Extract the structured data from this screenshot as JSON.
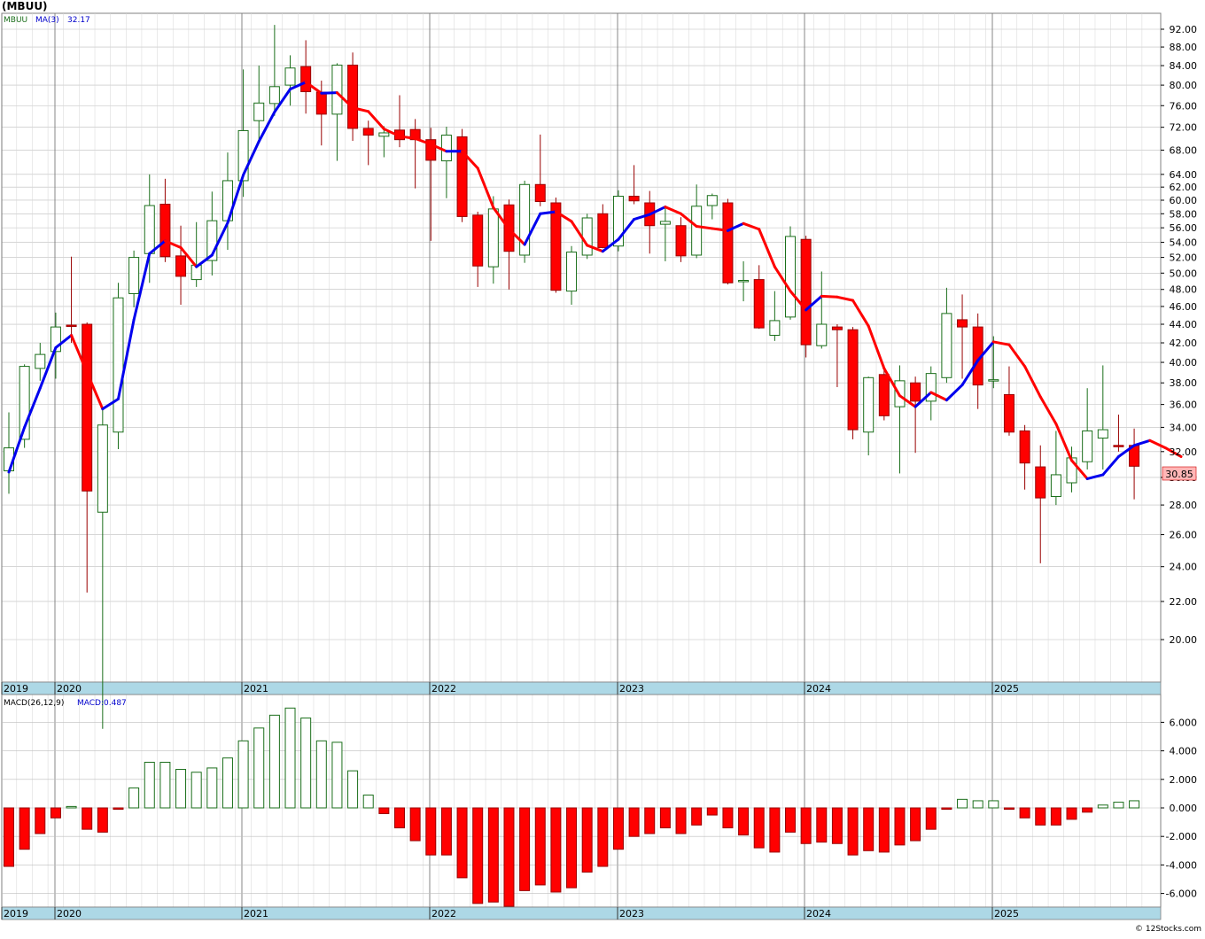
{
  "header": {
    "title": "(MBUU)",
    "legend_symbol": "MBUU",
    "legend_ma": "MA(3)",
    "legend_ma_value": "32.17",
    "macd_label": "MACD(26,12,9)",
    "macd_value_label": "MACD:0.487",
    "price_badge": "30.85",
    "footer": "© 12Stocks.com"
  },
  "colors": {
    "up": "#1a6e1a",
    "down": "#ff0000",
    "ma_up": "#0000ee",
    "ma_down": "#ff0000",
    "grid": "#bdbdbd",
    "year_band": "#add8e6",
    "badge_bg": "#ffb6b6"
  },
  "chart_data": [
    {
      "type": "candlestick",
      "name": "price",
      "y_ticks": [
        "92.00",
        "88.00",
        "84.00",
        "80.00",
        "76.00",
        "72.00",
        "68.00",
        "64.00",
        "62.00",
        "60.00",
        "58.00",
        "56.00",
        "54.00",
        "52.00",
        "50.00",
        "48.00",
        "46.00",
        "44.00",
        "42.00",
        "40.00",
        "38.00",
        "36.00",
        "34.00",
        "32.00",
        "30.00",
        "28.00",
        "26.00",
        "24.00",
        "22.00",
        "20.00"
      ],
      "x_labels": [
        "2019",
        "2020",
        "2021",
        "2022",
        "2023",
        "2024",
        "2025"
      ],
      "ylim": [
        17.5,
        96
      ],
      "scale": "log",
      "ma": [
        30.4,
        34.0,
        37.5,
        41.5,
        42.8,
        39.0,
        35.6,
        36.5,
        44.5,
        52.5,
        54.2,
        53.3,
        50.8,
        52.3,
        56.7,
        63.9,
        69.5,
        74.8,
        79.2,
        80.6,
        78.4,
        78.5,
        75.6,
        74.9,
        71.7,
        70.4,
        70.0,
        69.0,
        67.8,
        67.8,
        65.0,
        58.9,
        55.8,
        53.7,
        58.0,
        58.3,
        56.9,
        53.6,
        52.8,
        54.4,
        57.2,
        57.9,
        59.0,
        58.0,
        56.2,
        55.9,
        55.6,
        56.6,
        55.8,
        50.8,
        47.8,
        45.6,
        47.2,
        47.1,
        46.7,
        43.8,
        39.4,
        36.8,
        35.8,
        37.1,
        36.4,
        37.8,
        40.2,
        42.1,
        41.8,
        39.6,
        36.7,
        34.3,
        31.3,
        29.9,
        30.2,
        31.6,
        32.5,
        32.9,
        32.3,
        31.6
      ],
      "candles": [
        {
          "o": 30.5,
          "h": 35.3,
          "l": 28.8,
          "c": 32.3
        },
        {
          "o": 33.0,
          "h": 39.8,
          "l": 32.3,
          "c": 39.6
        },
        {
          "o": 39.4,
          "h": 42.0,
          "l": 38.2,
          "c": 40.8
        },
        {
          "o": 41.1,
          "h": 45.3,
          "l": 38.4,
          "c": 43.7
        },
        {
          "o": 43.9,
          "h": 52.1,
          "l": 42.0,
          "c": 43.8
        },
        {
          "o": 44.0,
          "h": 44.2,
          "l": 22.5,
          "c": 29.0
        },
        {
          "o": 27.5,
          "h": 35.6,
          "l": 16.0,
          "c": 34.2
        },
        {
          "o": 33.6,
          "h": 48.8,
          "l": 32.2,
          "c": 47.0
        },
        {
          "o": 47.5,
          "h": 52.9,
          "l": 45.9,
          "c": 52.0
        },
        {
          "o": 52.5,
          "h": 64.0,
          "l": 48.8,
          "c": 59.2
        },
        {
          "o": 59.4,
          "h": 63.3,
          "l": 51.4,
          "c": 52.1
        },
        {
          "o": 52.2,
          "h": 56.3,
          "l": 46.2,
          "c": 49.6
        },
        {
          "o": 49.2,
          "h": 56.8,
          "l": 48.3,
          "c": 51.0
        },
        {
          "o": 51.6,
          "h": 61.3,
          "l": 49.7,
          "c": 57.0
        },
        {
          "o": 57.0,
          "h": 67.6,
          "l": 53.0,
          "c": 63.0
        },
        {
          "o": 63.0,
          "h": 83.2,
          "l": 60.5,
          "c": 71.4
        },
        {
          "o": 73.2,
          "h": 84.0,
          "l": 69.5,
          "c": 76.5
        },
        {
          "o": 76.4,
          "h": 93.0,
          "l": 74.1,
          "c": 79.7
        },
        {
          "o": 80.0,
          "h": 86.2,
          "l": 76.0,
          "c": 83.5
        },
        {
          "o": 83.8,
          "h": 89.5,
          "l": 74.5,
          "c": 78.7
        },
        {
          "o": 78.6,
          "h": 80.9,
          "l": 68.8,
          "c": 74.4
        },
        {
          "o": 74.4,
          "h": 84.5,
          "l": 66.2,
          "c": 84.1
        },
        {
          "o": 84.1,
          "h": 86.8,
          "l": 69.6,
          "c": 71.8
        },
        {
          "o": 71.8,
          "h": 73.2,
          "l": 65.5,
          "c": 70.6
        },
        {
          "o": 70.4,
          "h": 72.2,
          "l": 66.8,
          "c": 71.0
        },
        {
          "o": 71.5,
          "h": 78.0,
          "l": 68.5,
          "c": 69.8
        },
        {
          "o": 71.6,
          "h": 73.5,
          "l": 61.8,
          "c": 69.8
        },
        {
          "o": 69.8,
          "h": 71.9,
          "l": 54.2,
          "c": 66.3
        },
        {
          "o": 66.2,
          "h": 72.1,
          "l": 60.3,
          "c": 70.6
        },
        {
          "o": 70.3,
          "h": 71.7,
          "l": 56.8,
          "c": 57.6
        },
        {
          "o": 57.8,
          "h": 58.3,
          "l": 48.3,
          "c": 50.9
        },
        {
          "o": 50.8,
          "h": 60.6,
          "l": 48.7,
          "c": 58.7
        },
        {
          "o": 59.3,
          "h": 60.1,
          "l": 48.0,
          "c": 52.8
        },
        {
          "o": 52.3,
          "h": 63.0,
          "l": 51.3,
          "c": 62.4
        },
        {
          "o": 62.4,
          "h": 70.7,
          "l": 59.1,
          "c": 59.8
        },
        {
          "o": 59.6,
          "h": 60.4,
          "l": 47.6,
          "c": 47.9
        },
        {
          "o": 47.8,
          "h": 53.5,
          "l": 46.2,
          "c": 52.7
        },
        {
          "o": 52.3,
          "h": 58.0,
          "l": 51.8,
          "c": 57.4
        },
        {
          "o": 58.0,
          "h": 59.4,
          "l": 53.2,
          "c": 53.3
        },
        {
          "o": 53.5,
          "h": 61.5,
          "l": 52.8,
          "c": 60.6
        },
        {
          "o": 60.6,
          "h": 65.5,
          "l": 59.4,
          "c": 59.9
        },
        {
          "o": 59.6,
          "h": 61.4,
          "l": 52.5,
          "c": 56.3
        },
        {
          "o": 56.5,
          "h": 59.2,
          "l": 51.5,
          "c": 56.9
        },
        {
          "o": 56.3,
          "h": 57.5,
          "l": 51.4,
          "c": 52.2
        },
        {
          "o": 52.3,
          "h": 62.4,
          "l": 51.9,
          "c": 59.1
        },
        {
          "o": 59.2,
          "h": 61.0,
          "l": 57.2,
          "c": 60.7
        },
        {
          "o": 59.6,
          "h": 60.2,
          "l": 48.6,
          "c": 48.8
        },
        {
          "o": 49.0,
          "h": 51.5,
          "l": 46.6,
          "c": 49.1
        },
        {
          "o": 49.2,
          "h": 51.0,
          "l": 43.5,
          "c": 43.6
        },
        {
          "o": 42.8,
          "h": 47.8,
          "l": 42.2,
          "c": 44.4
        },
        {
          "o": 44.8,
          "h": 56.2,
          "l": 44.5,
          "c": 54.8
        },
        {
          "o": 54.4,
          "h": 54.9,
          "l": 40.5,
          "c": 41.8
        },
        {
          "o": 41.7,
          "h": 50.2,
          "l": 41.4,
          "c": 44.0
        },
        {
          "o": 43.7,
          "h": 44.0,
          "l": 37.6,
          "c": 43.4
        },
        {
          "o": 43.4,
          "h": 43.7,
          "l": 33.0,
          "c": 33.8
        },
        {
          "o": 33.6,
          "h": 38.6,
          "l": 31.7,
          "c": 38.5
        },
        {
          "o": 38.8,
          "h": 39.7,
          "l": 34.6,
          "c": 35.0
        },
        {
          "o": 35.8,
          "h": 39.7,
          "l": 30.3,
          "c": 38.2
        },
        {
          "o": 38.0,
          "h": 38.6,
          "l": 31.9,
          "c": 36.3
        },
        {
          "o": 36.3,
          "h": 39.6,
          "l": 34.6,
          "c": 38.9
        },
        {
          "o": 38.5,
          "h": 48.2,
          "l": 38.0,
          "c": 45.2
        },
        {
          "o": 44.5,
          "h": 47.4,
          "l": 38.4,
          "c": 43.7
        },
        {
          "o": 43.7,
          "h": 45.2,
          "l": 35.6,
          "c": 37.8
        },
        {
          "o": 38.2,
          "h": 42.7,
          "l": 37.5,
          "c": 38.3
        },
        {
          "o": 36.9,
          "h": 39.6,
          "l": 33.3,
          "c": 33.6
        },
        {
          "o": 33.7,
          "h": 34.2,
          "l": 29.1,
          "c": 31.1
        },
        {
          "o": 30.8,
          "h": 32.5,
          "l": 24.2,
          "c": 28.5
        },
        {
          "o": 28.6,
          "h": 33.7,
          "l": 28.0,
          "c": 30.2
        },
        {
          "o": 29.6,
          "h": 32.4,
          "l": 28.9,
          "c": 31.5
        },
        {
          "o": 31.2,
          "h": 37.5,
          "l": 30.6,
          "c": 33.7
        },
        {
          "o": 33.1,
          "h": 39.7,
          "l": 30.6,
          "c": 33.8
        },
        {
          "o": 32.5,
          "h": 35.1,
          "l": 32.0,
          "c": 32.4
        },
        {
          "o": 32.5,
          "h": 33.9,
          "l": 28.4,
          "c": 30.85
        }
      ]
    },
    {
      "type": "bar",
      "name": "macd-histogram",
      "y_ticks": [
        "6.000",
        "4.000",
        "2.000",
        "0.000",
        "-2.000",
        "-4.000",
        "-6.000"
      ],
      "ylim": [
        -7.0,
        7.3
      ],
      "values": [
        -4.1,
        -2.9,
        -1.8,
        -0.7,
        0.1,
        -1.5,
        -1.7,
        -0.1,
        1.4,
        3.2,
        3.2,
        2.7,
        2.5,
        2.8,
        3.5,
        4.7,
        5.6,
        6.5,
        7.0,
        6.3,
        4.7,
        4.6,
        2.6,
        0.9,
        -0.4,
        -1.4,
        -2.3,
        -3.3,
        -3.3,
        -4.9,
        -6.7,
        -6.6,
        -6.9,
        -5.8,
        -5.4,
        -5.9,
        -5.6,
        -4.5,
        -4.1,
        -2.9,
        -2.0,
        -1.8,
        -1.4,
        -1.8,
        -1.2,
        -0.5,
        -1.4,
        -1.9,
        -2.8,
        -3.1,
        -1.7,
        -2.5,
        -2.4,
        -2.5,
        -3.3,
        -3.0,
        -3.1,
        -2.6,
        -2.3,
        -1.5,
        -0.1,
        0.6,
        0.5,
        0.5,
        -0.1,
        -0.7,
        -1.2,
        -1.2,
        -0.8,
        -0.3,
        0.2,
        0.4,
        0.5
      ]
    }
  ]
}
